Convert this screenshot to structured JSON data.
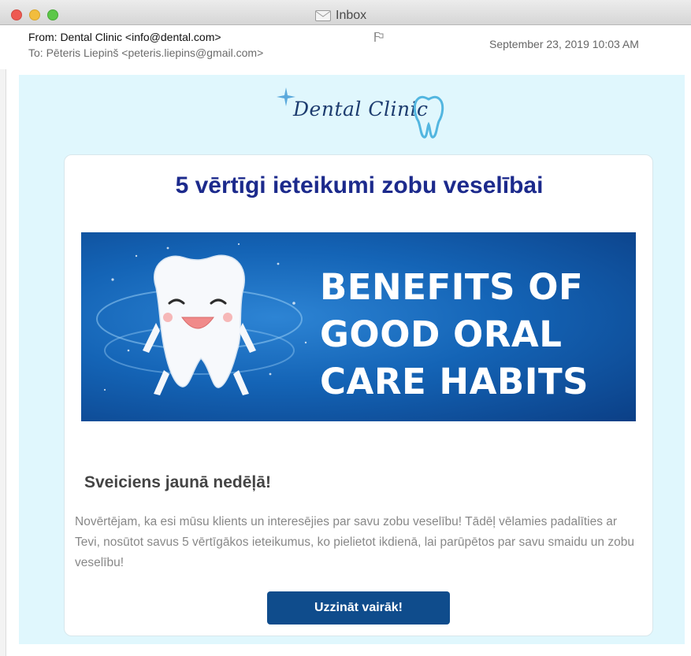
{
  "window": {
    "title": "Inbox",
    "controls": [
      "close",
      "minimize",
      "maximize"
    ]
  },
  "message_header": {
    "from": "From: Dental Clinic <info@dental.com>",
    "to": "To: Pēteris Liepinš <peteris.liepins@gmail.com>",
    "date": "September 23, 2019 10:03 AM",
    "icon": "flag-icon"
  },
  "email": {
    "logo_text": "Dental Clinic",
    "title": "5 vērtīgi ieteikumi zobu veselībai",
    "banner": {
      "lines": [
        "BENEFITS OF",
        "GOOD ORAL",
        "CARE HABITS"
      ],
      "colors": {
        "primary": "#1464b6",
        "dark": "#0b3f86"
      }
    },
    "greeting": "Sveiciens jaunā nedēļā!",
    "body": "Novērtējam, ka esi mūsu klients un interesējies par savu zobu veselību! Tādēļ vēlamies padalīties ar Tevi, nosūtot savus 5 vērtīgākos ieteikumus, ko pielietot ikdienā, lai parūpētos par savu smaidu un zobu veselību!",
    "cta_label": "Uzzināt vairāk!",
    "colors": {
      "background": "#e0f7fd",
      "title": "#1c2a8c",
      "button": "#0f4c8c"
    }
  }
}
